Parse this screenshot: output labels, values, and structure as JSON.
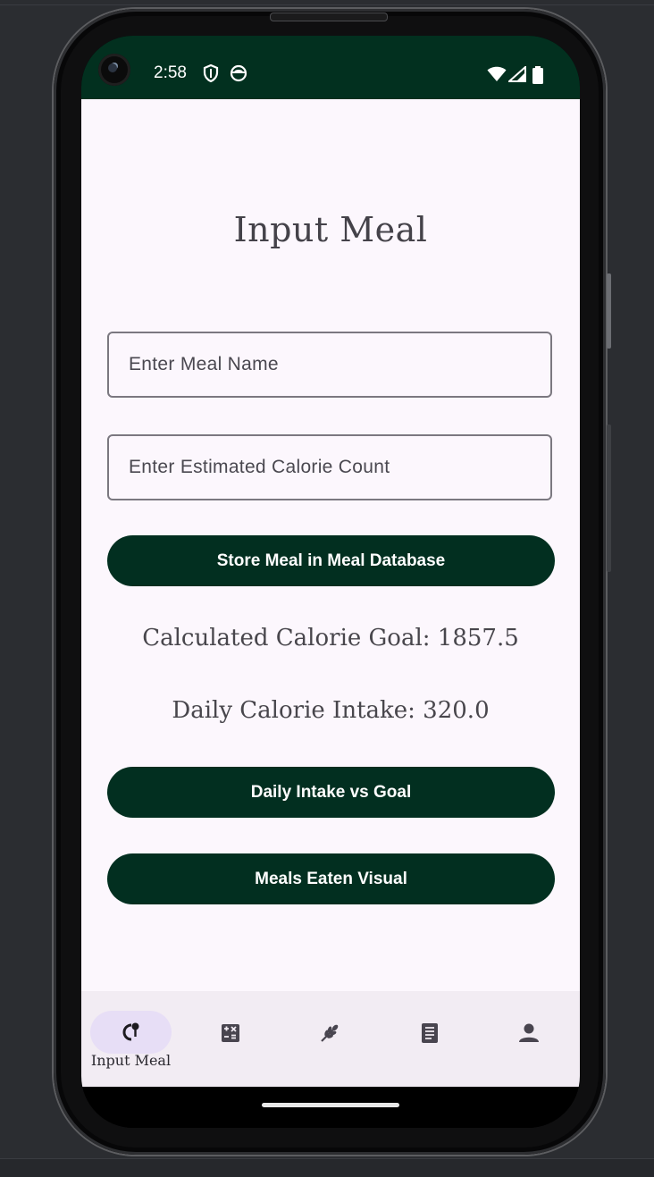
{
  "statusbar": {
    "time": "2:58",
    "icons": [
      "shield-icon",
      "face-icon",
      "wifi-icon",
      "signal-icon",
      "battery-icon"
    ]
  },
  "page": {
    "title": "Input Meal"
  },
  "form": {
    "meal_name_placeholder": "Enter Meal Name",
    "meal_name_value": "",
    "calorie_placeholder": "Enter Estimated Calorie Count",
    "calorie_value": "",
    "store_button": "Store Meal in Meal Database"
  },
  "stats": {
    "goal_text": "Calculated Calorie Goal: 1857.5",
    "intake_text": "Daily Calorie Intake: 320.0"
  },
  "actions": {
    "intake_vs_goal": "Daily Intake vs Goal",
    "meals_visual": "Meals Eaten Visual"
  },
  "bottom_nav": {
    "active_index": 0,
    "items": [
      {
        "label": "Input Meal",
        "icon": "meal-icon"
      },
      {
        "label": "",
        "icon": "calculator-icon"
      },
      {
        "label": "",
        "icon": "grain-icon"
      },
      {
        "label": "",
        "icon": "document-icon"
      },
      {
        "label": "",
        "icon": "profile-icon"
      }
    ]
  },
  "colors": {
    "primary": "#022f20",
    "background": "#fcf7fd",
    "nav_background": "#f2ecf3",
    "nav_active_indicator": "#e7def6",
    "text": "#444249"
  }
}
